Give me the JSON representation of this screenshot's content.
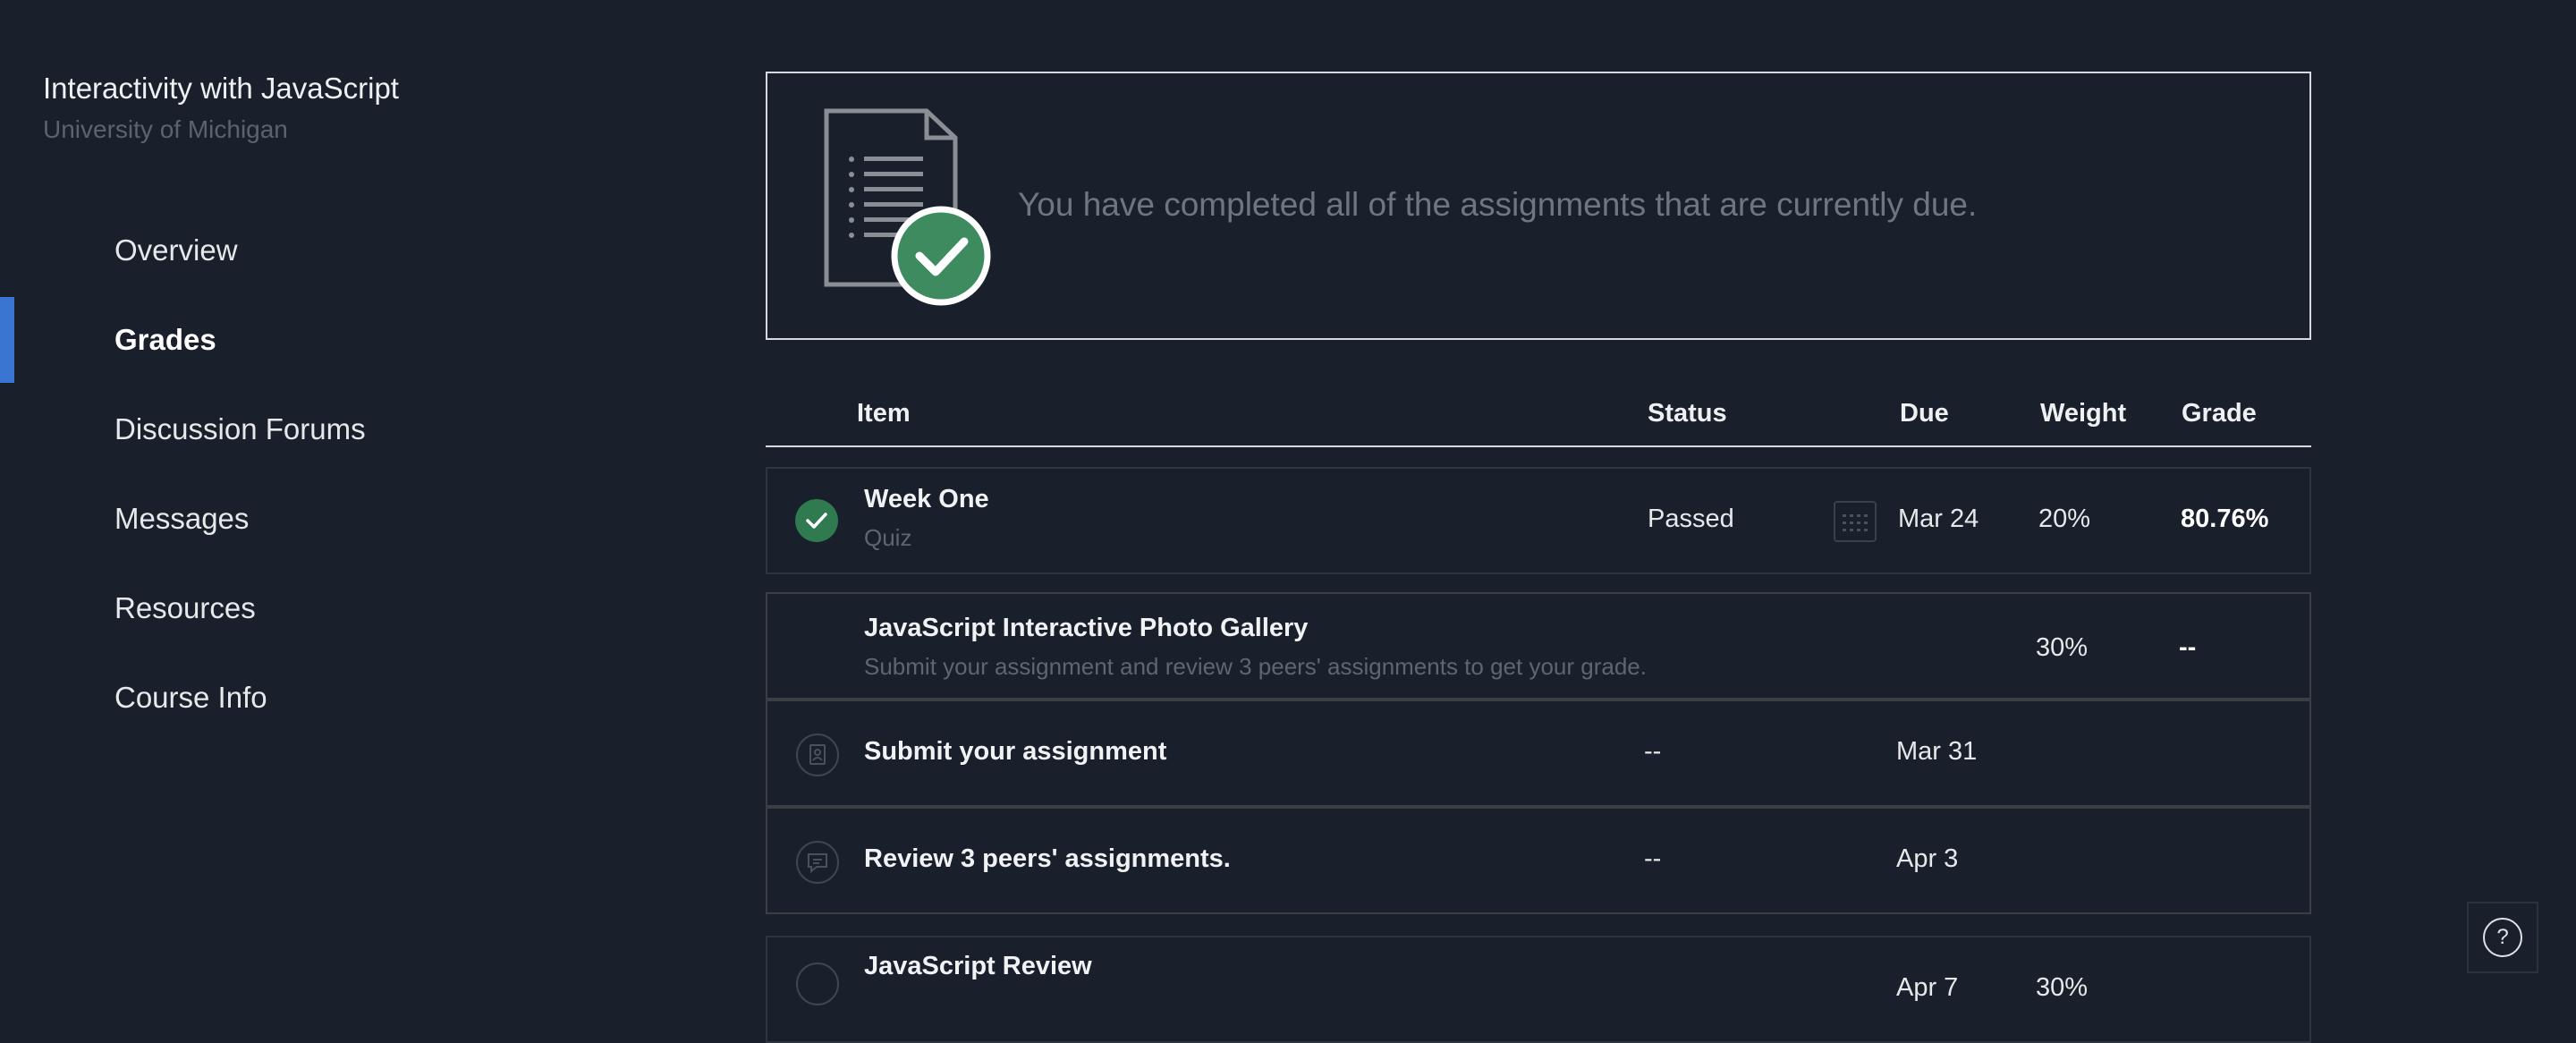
{
  "course": {
    "title": "Interactivity with JavaScript",
    "institution": "University of Michigan"
  },
  "nav": [
    {
      "label": "Overview",
      "active": false
    },
    {
      "label": "Grades",
      "active": true
    },
    {
      "label": "Discussion Forums",
      "active": false
    },
    {
      "label": "Messages",
      "active": false
    },
    {
      "label": "Resources",
      "active": false
    },
    {
      "label": "Course Info",
      "active": false
    }
  ],
  "banner": {
    "message": "You have completed all of the assignments that are currently due.",
    "icon": "document-check-icon"
  },
  "table": {
    "headers": {
      "item": "Item",
      "status": "Status",
      "due": "Due",
      "weight": "Weight",
      "grade": "Grade"
    },
    "rows": [
      {
        "title": "Week One",
        "subtitle": "Quiz",
        "status": "Passed",
        "due": "Mar 24",
        "weight": "20%",
        "grade": "80.76%",
        "icon": "check-circle-icon"
      },
      {
        "title": "JavaScript Interactive Photo Gallery",
        "subtitle": "Submit your assignment and review 3 peers' assignments to get your grade.",
        "weight": "30%",
        "grade": "--"
      },
      {
        "title": "Submit your assignment",
        "status": "--",
        "due": "Mar 31",
        "icon": "submission-icon"
      },
      {
        "title": "Review 3 peers' assignments.",
        "status": "--",
        "due": "Apr 3",
        "icon": "review-icon"
      },
      {
        "title": "JavaScript Review",
        "due": "Apr 7",
        "weight": "30%"
      }
    ]
  },
  "help": {
    "label": "?"
  },
  "colors": {
    "background": "#19202b",
    "accent": "#3a76d1",
    "success": "#2f7a4f"
  }
}
